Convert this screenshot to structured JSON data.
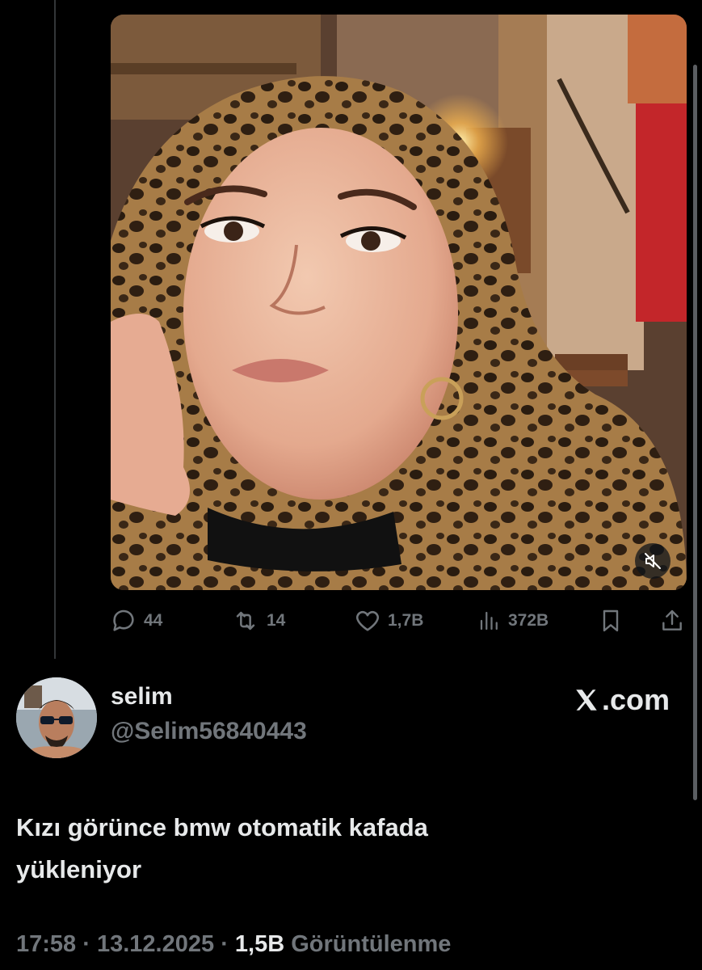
{
  "media": {
    "type": "video",
    "mute_icon": "volume-muted-icon"
  },
  "actions": {
    "replies": "44",
    "reposts": "14",
    "likes": "1,7B",
    "views": "372B",
    "reply_icon": "reply-icon",
    "repost_icon": "repost-icon",
    "like_icon": "heart-icon",
    "views_icon": "analytics-icon",
    "bookmark_icon": "bookmark-icon",
    "share_icon": "share-icon"
  },
  "author": {
    "display_name": "selim",
    "handle": "@Selim56840443"
  },
  "brand": {
    "logo_letter": "X",
    "domain_suffix": ".com"
  },
  "tweet": {
    "text_line1": "Kızı görünce bmw otomatik kafada",
    "text_line2": "yükleniyor"
  },
  "meta": {
    "time": "17:58",
    "separator": "·",
    "date": "13.12.2025",
    "views_count": "1,5B",
    "views_label": "Görüntülenme"
  },
  "colors": {
    "background": "#000000",
    "text_primary": "#e7e9ea",
    "text_secondary": "#71767b",
    "divider": "#333639"
  }
}
